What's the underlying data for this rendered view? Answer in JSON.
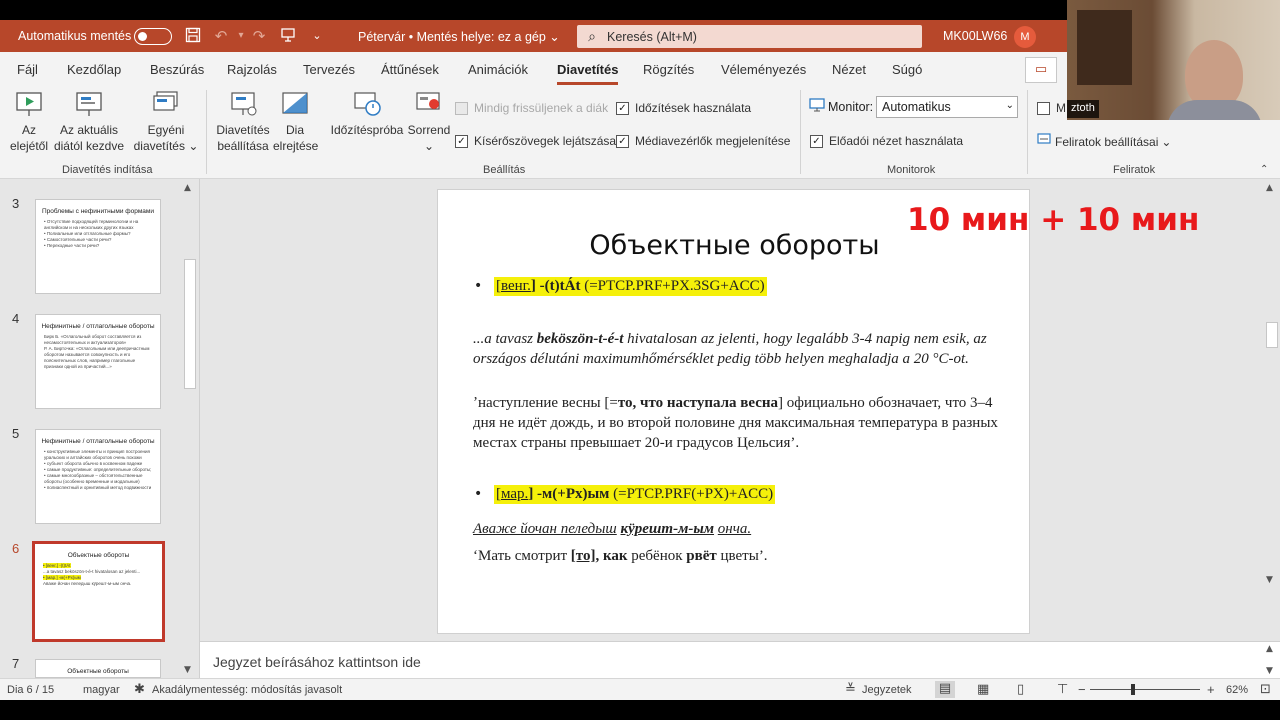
{
  "titlebar": {
    "autosave_label": "Automatikus mentés",
    "doc_title": "Pétervár • Mentés helye: ez a gép",
    "doc_caret": "⌄",
    "search_placeholder": "Keresés (Alt+M)",
    "user": "MK00LW66",
    "avatar_initial": "M"
  },
  "menu": {
    "tabs": [
      "Fájl",
      "Kezdőlap",
      "Beszúrás",
      "Rajzolás",
      "Tervezés",
      "Áttűnések",
      "Animációk",
      "Diavetítés",
      "Rögzítés",
      "Véleményezés",
      "Nézet",
      "Súgó"
    ],
    "active": "Diavetítés"
  },
  "ribbon": {
    "start": {
      "from_start_l1": "Az",
      "from_start_l2": "elejétől",
      "from_current_l1": "Az aktuális",
      "from_current_l2": "diától kezdve",
      "custom_l1": "Egyéni",
      "custom_l2": "diavetítés",
      "custom_caret": "⌄",
      "group": "Diavetítés indítása"
    },
    "setup": {
      "setup_l1": "Diavetítés",
      "setup_l2": "beállítása",
      "hide_l1": "Dia",
      "hide_l2": "elrejtése",
      "rehearse": "Időzítéspróba",
      "record": "Sorrend",
      "record_caret": "⌄",
      "keep_updated": "Mindig frissüljenek a diák",
      "use_timings": "Időzítések használata",
      "play_narrations": "Kísérőszövegek lejátszása",
      "show_media": "Médiavezérlők megjelenítése",
      "group": "Beállítás"
    },
    "monitors": {
      "monitor_label": "Monitor:",
      "monitor_value": "Automatikus",
      "presenter_view": "Előadói nézet használata",
      "group": "Monitorok"
    },
    "captions": {
      "subtitle_partial": "M",
      "settings": "Feliratok beállításai",
      "settings_caret": "⌄",
      "group": "Feliratok"
    }
  },
  "webcam": {
    "name": "ztoth"
  },
  "thumbnails": [
    {
      "num": "3",
      "title": "Проблемы с нефинитными формами",
      "lines": [
        "• Отсутствие подходящей терминологии и на английском и на нескольких других языках",
        "• Полиальные или отглагольные формы?",
        "• Самостоятельные части речи?",
        "• Переходные части речи?"
      ]
    },
    {
      "num": "4",
      "title": "Нефинитные / отглагольные обороты",
      "lines": [
        "Бирк Б. «Оглагольный оборот составляется из несамостоятельных и актуализаторов»",
        "Р. А. Бирточка: «Оглагольным или деепричастным оборотом называется совокупность и его пояснительных слов, например глагольные признаки одной из причастий...»"
      ]
    },
    {
      "num": "5",
      "title": "Нефинитные / отглагольные обороты",
      "lines": [
        "• конструктивные элементы и принцип построения уральских и алтайских оборотов очень похожи",
        "• субъект оборота обычно в косвенном падеже",
        "• самые продуктивные: определительные обороты;",
        "• самые многообразные – обстоятельственные обороты (особенно временные и модальные)",
        "• полиаспектный и орнитивный метод подвижности"
      ]
    },
    {
      "num": "6",
      "title": "Объектные обороты",
      "lines": [
        "• [венг.] -(t)tÁt",
        "...a tavasz beköszön-t-é-t hivatalosan az jelenti...",
        "• [мар.] -м(+Рх)ым",
        "Аваже йочан пеледыш кӱрешт-м-ым онча."
      ]
    },
    {
      "num": "7",
      "title": "Объектные обороты",
      "lines": []
    }
  ],
  "slide": {
    "title": "Объектные обороты",
    "bullet1_prefix": "[",
    "bullet1_lang": "венг.",
    "bullet1_rest": "] -(t)tÁt",
    "bullet1_gloss": " (=PTCP.PRF+PX.3SG+ACC)",
    "hu_l1": "...a tavasz",
    "hu_bold": "beköszön-t-é-t",
    "hu_l1_rest": "hivatalosan az jelenti, hogy legalább 3-4 napig nem esik, az országos délutáni maximumhőmérséklet pedig több helyen meghaladja a 20 °C-ot.",
    "ru_tr_start": "ʼнаступление весны [=",
    "ru_tr_bold": "то, что наступала весна",
    "ru_tr_rest": "] официально обозначает, что 3–4 дня не идёт дождь, и во второй половине дня максимальная температура в разных местах страны превышает 20-и градусов Цельсия’.",
    "bullet2_prefix": "[",
    "bullet2_lang": "мар.",
    "bullet2_rest": "] -м(+Рх)ым",
    "bullet2_gloss": " (=PTCP.PRF(+PX)+ACC)",
    "mari_start": "Аваже йочан пеледыш",
    "mari_bold": "кӱрешт-м-ым",
    "mari_end": "онча.",
    "mari_tr_start": "‘Мать смотрит ",
    "mari_tr_bracket": "[то]",
    "mari_tr_comma": ", как",
    "mari_tr_mid": " ребёнок ",
    "mari_tr_bold": "рвёт",
    "mari_tr_end": " цветы’."
  },
  "overlay_text": "10 мин + 10 мин",
  "notes_placeholder": "Jegyzet beírásához kattintson ide",
  "status": {
    "slide": "Dia 6 / 15",
    "language": "magyar",
    "accessibility": "Akadálymentesség: módosítás javasolt",
    "notes": "Jegyzetek",
    "zoom": "62%",
    "zoom_minus": "−",
    "zoom_plus": "+"
  },
  "colors": {
    "accent": "#b7472a",
    "highlight": "#f5f00a",
    "timer": "#e8191b"
  }
}
